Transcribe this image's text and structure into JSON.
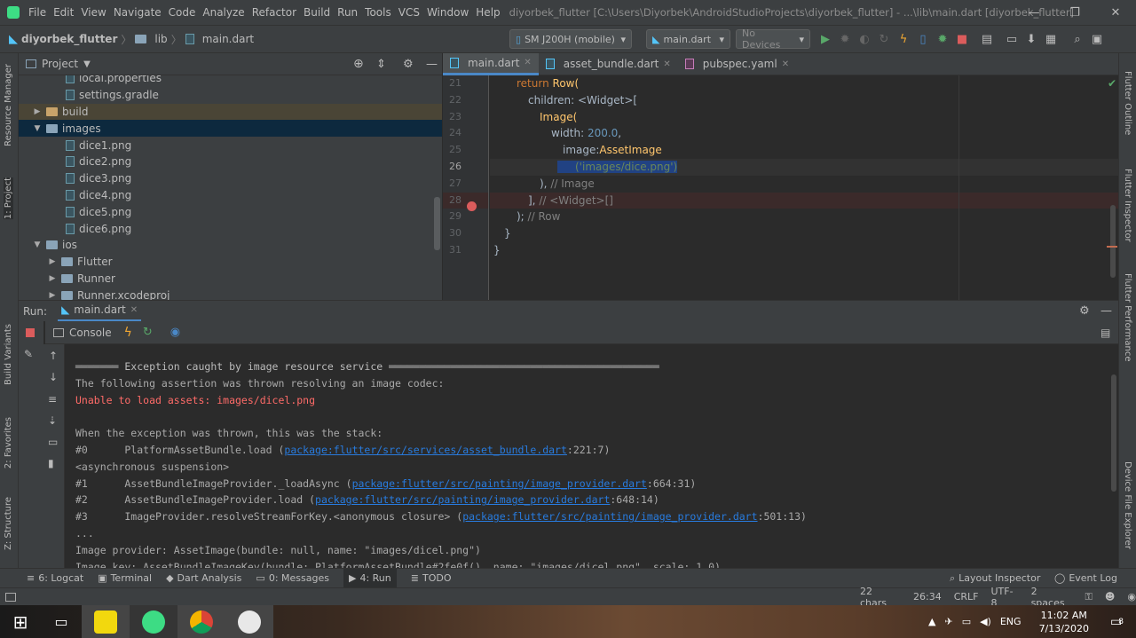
{
  "menu": [
    "File",
    "Edit",
    "View",
    "Navigate",
    "Code",
    "Analyze",
    "Refactor",
    "Build",
    "Run",
    "Tools",
    "VCS",
    "Window",
    "Help"
  ],
  "window_title": "diyorbek_flutter [C:\\Users\\Diyorbek\\AndroidStudioProjects\\diyorbek_flutter] - ...\\lib\\main.dart [diyorbek_flutter]",
  "breadcrumb": {
    "project": "diyorbek_flutter",
    "folder": "lib",
    "file": "main.dart"
  },
  "toolbar": {
    "device": "SM J200H (mobile)",
    "run_config": "main.dart",
    "devices": "No Devices"
  },
  "project_panel": {
    "title": "Project"
  },
  "tree": [
    {
      "label": "local.properties",
      "indent": 3,
      "kind": "file-props"
    },
    {
      "label": "settings.gradle",
      "indent": 3,
      "kind": "file-gradle"
    },
    {
      "label": "build",
      "indent": 1,
      "kind": "folder-orange",
      "arrow": "▶"
    },
    {
      "label": "images",
      "indent": 1,
      "kind": "folder",
      "arrow": "▼",
      "selected": true
    },
    {
      "label": "dice1.png",
      "indent": 3,
      "kind": "file"
    },
    {
      "label": "dice2.png",
      "indent": 3,
      "kind": "file"
    },
    {
      "label": "dice3.png",
      "indent": 3,
      "kind": "file"
    },
    {
      "label": "dice4.png",
      "indent": 3,
      "kind": "file"
    },
    {
      "label": "dice5.png",
      "indent": 3,
      "kind": "file"
    },
    {
      "label": "dice6.png",
      "indent": 3,
      "kind": "file"
    },
    {
      "label": "ios",
      "indent": 1,
      "kind": "folder",
      "arrow": "▼"
    },
    {
      "label": "Flutter",
      "indent": 2,
      "kind": "folder",
      "arrow": "▶"
    },
    {
      "label": "Runner",
      "indent": 2,
      "kind": "folder",
      "arrow": "▶"
    },
    {
      "label": "Runner.xcodeproj",
      "indent": 2,
      "kind": "folder",
      "arrow": "▶"
    }
  ],
  "editor_tabs": [
    "main.dart",
    "asset_bundle.dart",
    "pubspec.yaml"
  ],
  "line_numbers": [
    "21",
    "22",
    "23",
    "24",
    "25",
    "26",
    "27",
    "28",
    "29",
    "30",
    "31"
  ],
  "code": {
    "l21a": "return ",
    "l21b": "Row(",
    "l22": "children: <Widget>[",
    "l23": "Image(",
    "l24a": "width: ",
    "l24b": "200.0",
    ",": ",",
    "l25a": "image:",
    "l25b": "AssetImage",
    "l26": "('images/dice.png')",
    "l27a": "), ",
    "l27b": "// Image",
    "l28a": "], ",
    "l28b": "// <Widget>[]",
    "l29a": "); ",
    "l29b": "// Row",
    "l30": "}",
    "l31": "}"
  },
  "run": {
    "label": "Run:",
    "tab": "main.dart",
    "console": "Console"
  },
  "console": {
    "l1": "═══════ Exception caught by image resource service ════════════════════════════════════════════",
    "l2": "The following assertion was thrown resolving an image codec:",
    "l3": "Unable to load assets: images/dicel.png",
    "l4": "When the exception was thrown, this was the stack:",
    "l5a": "#0      PlatformAssetBundle.load (",
    "l5b": "package:flutter/src/services/asset_bundle.dart",
    "l5c": ":221:7)",
    "l6": "<asynchronous suspension>",
    "l7a": "#1      AssetBundleImageProvider._loadAsync (",
    "l7b": "package:flutter/src/painting/image_provider.dart",
    "l7c": ":664:31)",
    "l8a": "#2      AssetBundleImageProvider.load (",
    "l8b": "package:flutter/src/painting/image_provider.dart",
    "l8c": ":648:14)",
    "l9a": "#3      ImageProvider.resolveStreamForKey.<anonymous closure> (",
    "l9b": "package:flutter/src/painting/image_provider.dart",
    "l9c": ":501:13)",
    "l10": "...",
    "l11": "Image provider: AssetImage(bundle: null, name: \"images/dicel.png\")",
    "l12": "Image key: AssetBundleImageKey(bundle: PlatformAssetBundle#2fe0f(), name: \"images/dicel.png\", scale: 1.0)"
  },
  "left_strip": [
    "Resource Manager",
    "1: Project",
    "Build Variants",
    "2: Favorites",
    "Z: Structure"
  ],
  "right_strip": [
    "Flutter Outline",
    "Flutter Inspector",
    "Flutter Performance",
    "Device File Explorer"
  ],
  "bottom_tabs": [
    "6: Logcat",
    "Terminal",
    "Dart Analysis",
    "0: Messages",
    "4: Run",
    "TODO"
  ],
  "bottom_right": [
    "Layout Inspector",
    "Event Log"
  ],
  "status": [
    "22 chars",
    "26:34",
    "CRLF",
    "UTF-8",
    "2 spaces"
  ],
  "taskbar": {
    "lang": "ENG",
    "time": "11:02 AM",
    "date": "7/13/2020",
    "notif": "8"
  }
}
